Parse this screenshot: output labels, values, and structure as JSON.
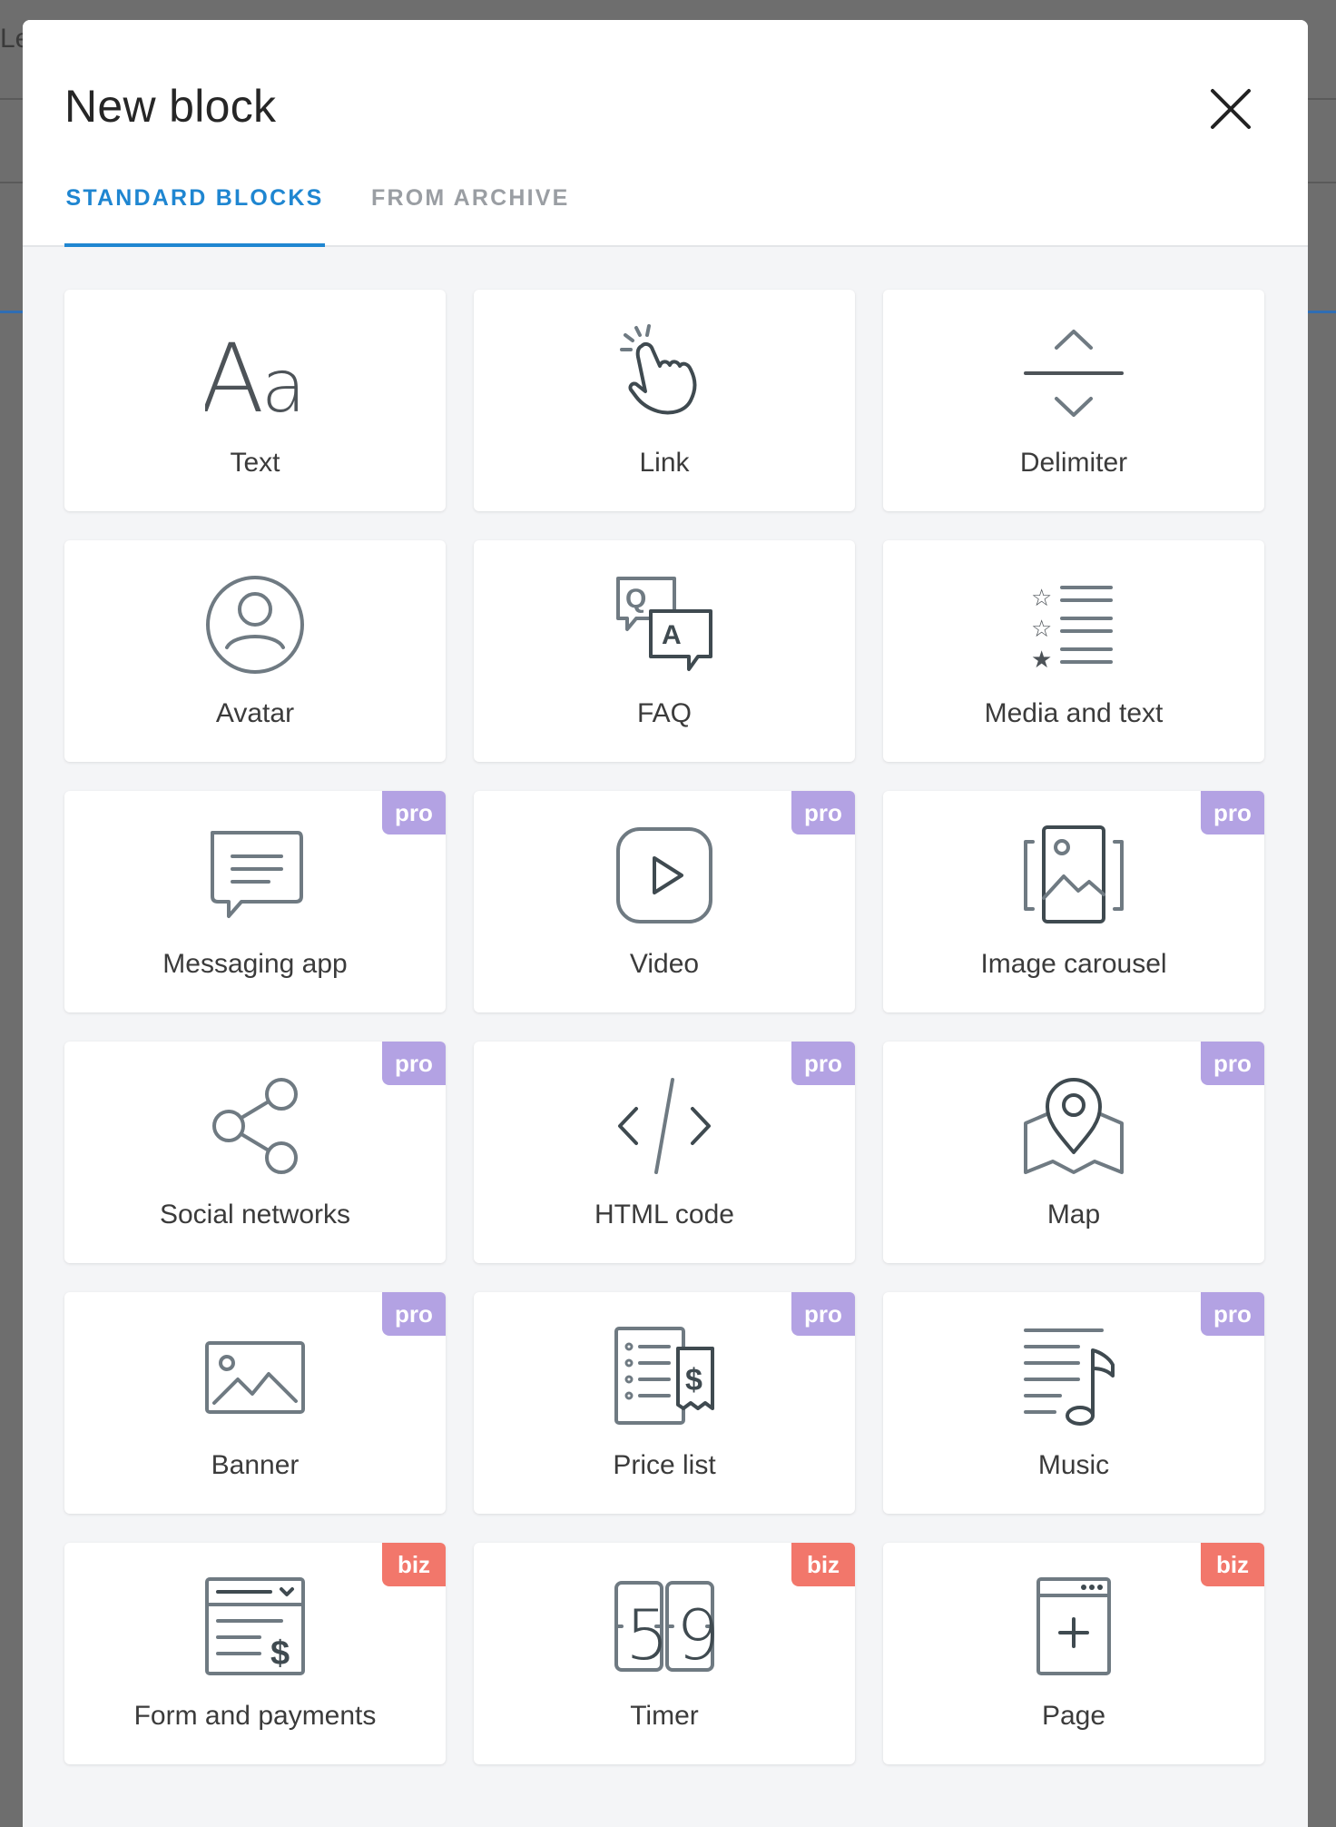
{
  "background": {
    "fragment_text": "Le"
  },
  "modal": {
    "title": "New block",
    "tabs": [
      {
        "label": "STANDARD BLOCKS",
        "active": true
      },
      {
        "label": "FROM ARCHIVE",
        "active": false
      }
    ]
  },
  "colors": {
    "accent": "#1f86d1",
    "pro_badge": "#b3a2e3",
    "biz_badge": "#f2776b",
    "icon": "#6f7a82"
  },
  "blocks": [
    {
      "label": "Text",
      "icon": "text-icon",
      "badge": ""
    },
    {
      "label": "Link",
      "icon": "pointer-hand-icon",
      "badge": ""
    },
    {
      "label": "Delimiter",
      "icon": "delimiter-icon",
      "badge": ""
    },
    {
      "label": "Avatar",
      "icon": "avatar-icon",
      "badge": ""
    },
    {
      "label": "FAQ",
      "icon": "faq-icon",
      "badge": ""
    },
    {
      "label": "Media and text",
      "icon": "media-text-icon",
      "badge": ""
    },
    {
      "label": "Messaging app",
      "icon": "message-icon",
      "badge": "pro"
    },
    {
      "label": "Video",
      "icon": "video-play-icon",
      "badge": "pro"
    },
    {
      "label": "Image carousel",
      "icon": "image-carousel-icon",
      "badge": "pro"
    },
    {
      "label": "Social networks",
      "icon": "share-icon",
      "badge": "pro"
    },
    {
      "label": "HTML code",
      "icon": "code-icon",
      "badge": "pro"
    },
    {
      "label": "Map",
      "icon": "map-pin-icon",
      "badge": "pro"
    },
    {
      "label": "Banner",
      "icon": "banner-image-icon",
      "badge": "pro"
    },
    {
      "label": "Price list",
      "icon": "price-list-icon",
      "badge": "pro"
    },
    {
      "label": "Music",
      "icon": "music-icon",
      "badge": "pro"
    },
    {
      "label": "Form and payments",
      "icon": "form-payment-icon",
      "badge": "biz"
    },
    {
      "label": "Timer",
      "icon": "timer-icon",
      "badge": "biz"
    },
    {
      "label": "Page",
      "icon": "add-page-icon",
      "badge": "biz"
    }
  ]
}
